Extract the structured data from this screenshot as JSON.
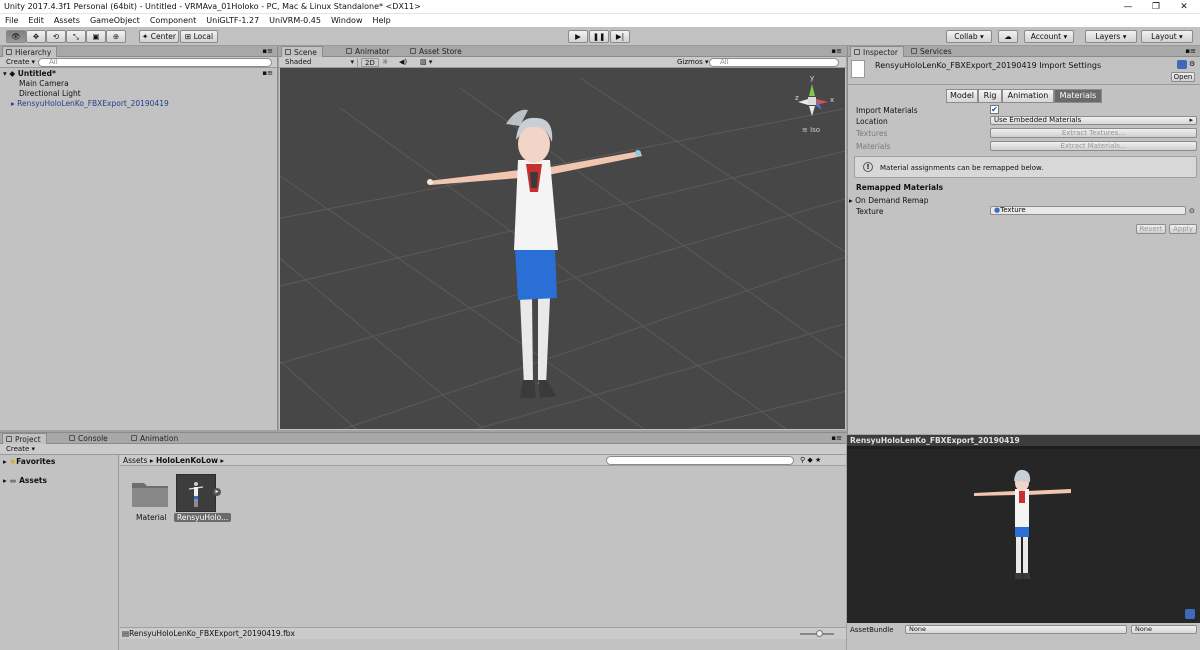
{
  "window": {
    "title": "Unity 2017.4.3f1 Personal (64bit) - Untitled - VRMAva_01Holoko - PC, Mac & Linux Standalone* <DX11>",
    "min": "—",
    "max": "❐",
    "close": "✕"
  },
  "menu": [
    "File",
    "Edit",
    "Assets",
    "GameObject",
    "Component",
    "UniGLTF-1.27",
    "UniVRM-0.45",
    "Window",
    "Help"
  ],
  "toolbar": {
    "pivot": "Center",
    "space": "Local",
    "collab": "Collab ▾",
    "account": "Account",
    "layers": "Layers",
    "layout": "Layout"
  },
  "hierarchy": {
    "tab": "Hierarchy",
    "create": "Create",
    "search_placeholder": "All",
    "scene": "Untitled*",
    "items": [
      "Main Camera",
      "Directional Light",
      "RensyuHoloLenKo_FBXExport_20190419"
    ]
  },
  "scene": {
    "tabs": [
      "Scene",
      "Animator",
      "Asset Store"
    ],
    "shading": "Shaded",
    "mode2d": "2D",
    "gizmos": "Gizmos",
    "search_placeholder": "All",
    "iso": "Iso",
    "axis": {
      "x": "x",
      "y": "y",
      "z": "z"
    }
  },
  "project": {
    "tabs": [
      "Project",
      "Console",
      "Animation"
    ],
    "create": "Create",
    "favorites": "Favorites",
    "assets": "Assets",
    "breadcrumb": [
      "Assets",
      "HoloLenKoLow"
    ],
    "breadcrumb_sep": "▸",
    "items": [
      {
        "label": "Material"
      },
      {
        "label": "RensyuHolo..."
      }
    ],
    "status": "RensyuHoloLenKo_FBXExport_20190419.fbx"
  },
  "inspector": {
    "tabs": [
      "Inspector",
      "Services"
    ],
    "title": "RensyuHoloLenKo_FBXExport_20190419 Import Settings",
    "open": "Open",
    "modes": [
      "Model",
      "Rig",
      "Animation",
      "Materials"
    ],
    "active_mode": "Materials",
    "import_materials_label": "Import Materials",
    "import_materials": true,
    "location_label": "Location",
    "location_value": "Use Embedded Materials",
    "textures_label": "Textures",
    "extract_textures": "Extract Textures...",
    "materials_label": "Materials",
    "extract_materials": "Extract Materials...",
    "info": "Material assignments can be remapped below.",
    "remapped_header": "Remapped Materials",
    "on_demand": "On Demand Remap",
    "texture_label": "Texture",
    "texture_value": "Texture",
    "revert": "Revert",
    "apply": "Apply"
  },
  "preview": {
    "title": "RensyuHoloLenKo_FBXExport_20190419",
    "assetbundle_label": "AssetBundle",
    "bundle": "None",
    "variant": "None"
  },
  "colors": {
    "panel": "#c2c2c2",
    "scene_bg": "#474747",
    "preview_bg": "#1f1f1f",
    "selection": "#3d6bb5",
    "accent_pants": "#2a6fd6",
    "accent_collar": "#c83030"
  }
}
